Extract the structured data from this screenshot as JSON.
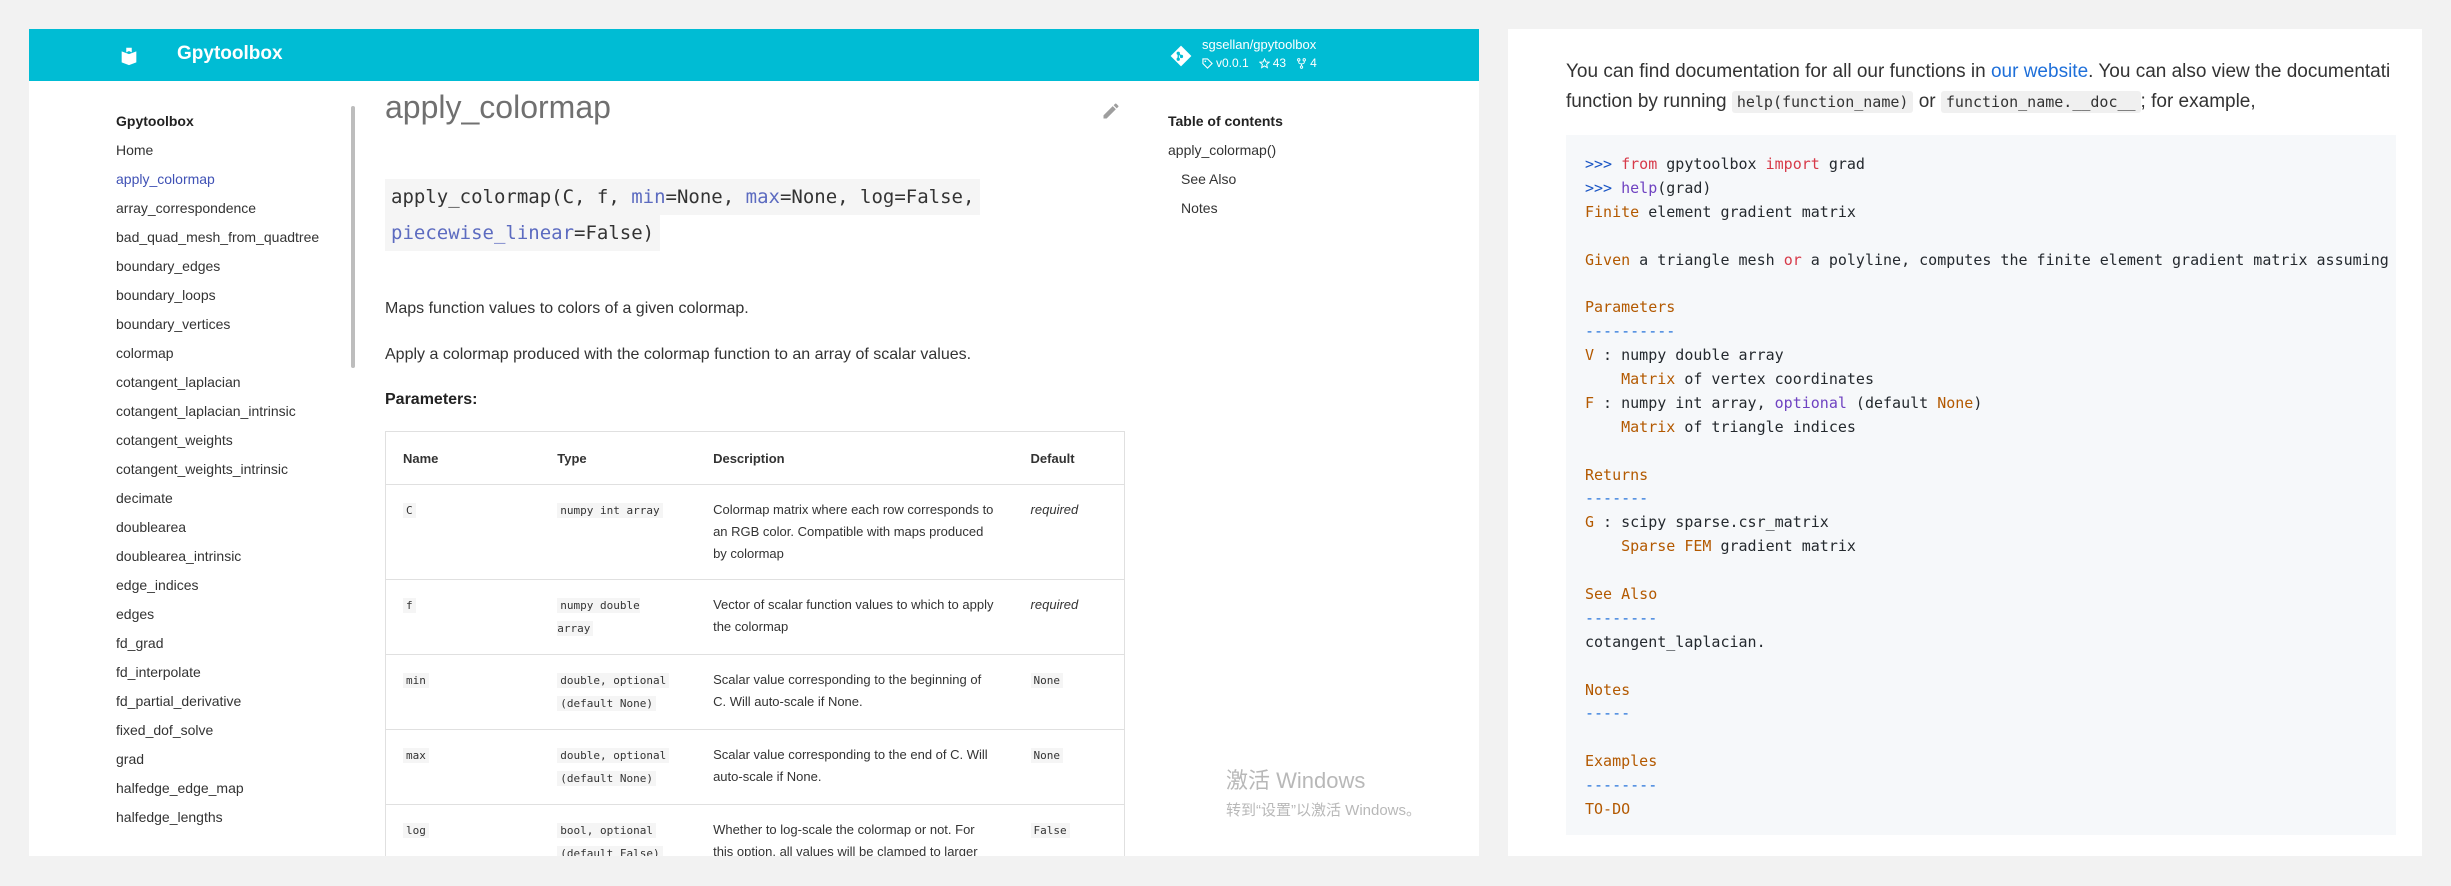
{
  "header": {
    "site_title": "Gpytoolbox",
    "repo_name": "sgsellan/gpytoolbox",
    "repo_version": "v0.0.1",
    "repo_stars": "43",
    "repo_forks": "4"
  },
  "sidebar": {
    "title": "Gpytoolbox",
    "items": [
      {
        "label": "Home"
      },
      {
        "label": "apply_colormap",
        "active": true
      },
      {
        "label": "array_correspondence"
      },
      {
        "label": "bad_quad_mesh_from_quadtree"
      },
      {
        "label": "boundary_edges"
      },
      {
        "label": "boundary_loops"
      },
      {
        "label": "boundary_vertices"
      },
      {
        "label": "colormap"
      },
      {
        "label": "cotangent_laplacian"
      },
      {
        "label": "cotangent_laplacian_intrinsic"
      },
      {
        "label": "cotangent_weights"
      },
      {
        "label": "cotangent_weights_intrinsic"
      },
      {
        "label": "decimate"
      },
      {
        "label": "doublearea"
      },
      {
        "label": "doublearea_intrinsic"
      },
      {
        "label": "edge_indices"
      },
      {
        "label": "edges"
      },
      {
        "label": "fd_grad"
      },
      {
        "label": "fd_interpolate"
      },
      {
        "label": "fd_partial_derivative"
      },
      {
        "label": "fixed_dof_solve"
      },
      {
        "label": "grad"
      },
      {
        "label": "halfedge_edge_map"
      },
      {
        "label": "halfedge_lengths"
      }
    ]
  },
  "main": {
    "title": "apply_colormap",
    "signature": {
      "fn": "apply_colormap(C, f, ",
      "k_min": "min",
      "v_min": "=None, ",
      "k_max": "max",
      "v_max": "=None, log=False,",
      "k_pw": "piecewise_linear",
      "v_pw": "=False)"
    },
    "summary": "Maps function values to colors of a given colormap.",
    "description": "Apply a colormap produced with the colormap function to an array of scalar values.",
    "params_heading": "Parameters:",
    "table_headers": [
      "Name",
      "Type",
      "Description",
      "Default"
    ],
    "params": [
      {
        "name": "C",
        "type": "numpy int array",
        "type_extra": "",
        "desc": "Colormap matrix where each row corresponds to an RGB color. Compatible with maps produced by colormap",
        "default": "required",
        "default_is_code": false
      },
      {
        "name": "f",
        "type": "numpy double array",
        "type_extra": "",
        "desc": "Vector of scalar function values to which to apply the colormap",
        "default": "required",
        "default_is_code": false
      },
      {
        "name": "min",
        "type": "double, optional",
        "type_extra": "(default None)",
        "desc": "Scalar value corresponding to the beginning of C. Will auto-scale if None.",
        "default": "None",
        "default_is_code": true
      },
      {
        "name": "max",
        "type": "double, optional",
        "type_extra": "(default None)",
        "desc": "Scalar value corresponding to the end of C. Will auto-scale if None.",
        "default": "None",
        "default_is_code": true
      },
      {
        "name": "log",
        "type": "bool, optional",
        "type_extra": "(default False)",
        "desc": "Whether to log-scale the colormap or not. For this option, all values will be clamped to larger than machine epsilon.",
        "default": "False",
        "default_is_code": true
      }
    ]
  },
  "toc": {
    "title": "Table of contents",
    "items": [
      {
        "label": "apply_colormap()",
        "sub": false
      },
      {
        "label": "See Also",
        "sub": true
      },
      {
        "label": "Notes",
        "sub": true
      }
    ]
  },
  "watermark": {
    "line1": "激活 Windows",
    "line2": "转到“设置”以激活 Windows。"
  },
  "right": {
    "intro_1": "You can find documentation for all our functions in ",
    "intro_link": "our website",
    "intro_2": ". You can also view the documentati",
    "intro_3": "function by running ",
    "code_help": "help(function_name)",
    "intro_or": " or ",
    "code_doc": "function_name.__doc__",
    "intro_4": "; for example,",
    "code_lines": [
      [
        {
          "t": ">>> ",
          "c": "c-prompt"
        },
        {
          "t": "from",
          "c": "c-kw"
        },
        {
          "t": " gpytoolbox ",
          "c": ""
        },
        {
          "t": "import",
          "c": "c-kw"
        },
        {
          "t": " grad",
          "c": ""
        }
      ],
      [
        {
          "t": ">>> ",
          "c": "c-prompt"
        },
        {
          "t": "help",
          "c": "c-fn"
        },
        {
          "t": "(grad)",
          "c": ""
        }
      ],
      [
        {
          "t": "Finite",
          "c": "c-h"
        },
        {
          "t": " element gradient matrix",
          "c": ""
        }
      ],
      [],
      [
        {
          "t": "Given",
          "c": "c-h"
        },
        {
          "t": " a triangle mesh ",
          "c": ""
        },
        {
          "t": "or",
          "c": "c-kw"
        },
        {
          "t": " a polyline, computes the finite element gradient matrix assuming",
          "c": ""
        }
      ],
      [],
      [
        {
          "t": "Parameters",
          "c": "c-h"
        }
      ],
      [
        {
          "t": "----------",
          "c": "c-dash"
        }
      ],
      [
        {
          "t": "V",
          "c": "c-h"
        },
        {
          "t": " : numpy double array",
          "c": ""
        }
      ],
      [
        {
          "t": "    ",
          "c": ""
        },
        {
          "t": "Matrix",
          "c": "c-h"
        },
        {
          "t": " of vertex coordinates",
          "c": ""
        }
      ],
      [
        {
          "t": "F",
          "c": "c-h"
        },
        {
          "t": " : numpy int array, ",
          "c": ""
        },
        {
          "t": "optional",
          "c": "c-opt"
        },
        {
          "t": " (default ",
          "c": ""
        },
        {
          "t": "None",
          "c": "c-none"
        },
        {
          "t": ")",
          "c": ""
        }
      ],
      [
        {
          "t": "    ",
          "c": ""
        },
        {
          "t": "Matrix",
          "c": "c-h"
        },
        {
          "t": " of triangle indices",
          "c": ""
        }
      ],
      [],
      [
        {
          "t": "Returns",
          "c": "c-h"
        }
      ],
      [
        {
          "t": "-------",
          "c": "c-dash"
        }
      ],
      [
        {
          "t": "G",
          "c": "c-h"
        },
        {
          "t": " : scipy sparse.csr_matrix",
          "c": ""
        }
      ],
      [
        {
          "t": "    ",
          "c": ""
        },
        {
          "t": "Sparse FEM",
          "c": "c-h"
        },
        {
          "t": " gradient matrix",
          "c": ""
        }
      ],
      [],
      [
        {
          "t": "See Also",
          "c": "c-h"
        }
      ],
      [
        {
          "t": "--------",
          "c": "c-dash"
        }
      ],
      [
        {
          "t": "cotangent_laplacian.",
          "c": ""
        }
      ],
      [],
      [
        {
          "t": "Notes",
          "c": "c-h"
        }
      ],
      [
        {
          "t": "-----",
          "c": "c-dash"
        }
      ],
      [],
      [
        {
          "t": "Examples",
          "c": "c-h"
        }
      ],
      [
        {
          "t": "--------",
          "c": "c-dash"
        }
      ],
      [
        {
          "t": "TO-DO",
          "c": "c-h"
        }
      ]
    ]
  }
}
